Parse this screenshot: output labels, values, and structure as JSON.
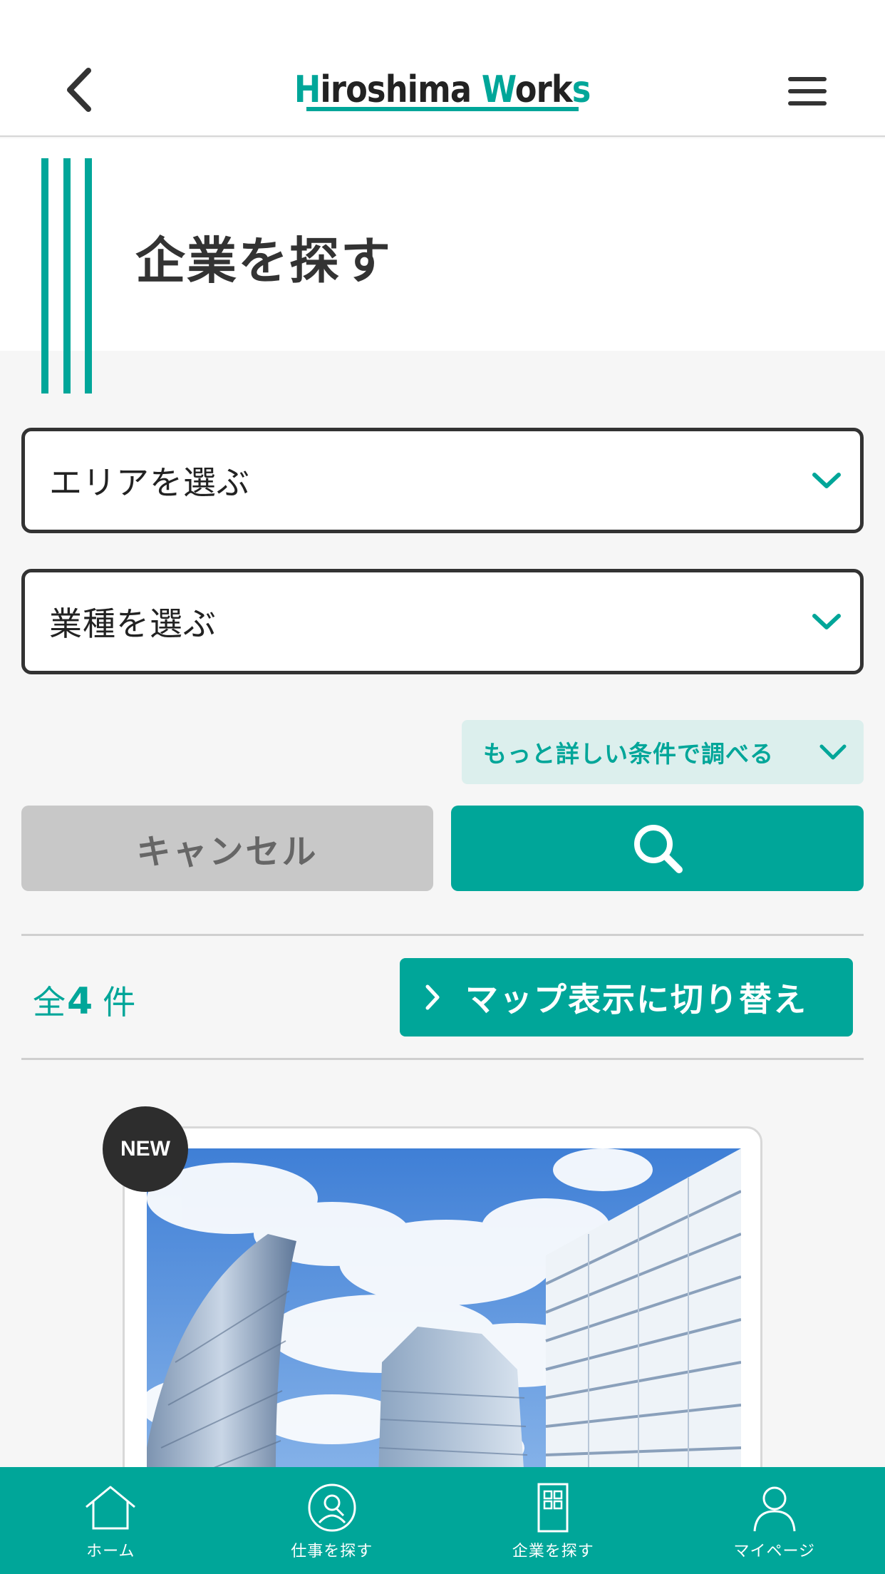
{
  "header": {
    "logo_prefix_H": "H",
    "logo_mid": "iroshima ",
    "logo_W": "W",
    "logo_ork": "ork",
    "logo_s": "s"
  },
  "page": {
    "title": "企業を探す"
  },
  "filters": {
    "area_select": "エリアを選ぶ",
    "industry_select": "業種を選ぶ",
    "more_filters": "もっと詳しい条件で調べる"
  },
  "actions": {
    "cancel": "キャンセル"
  },
  "results": {
    "prefix": "全",
    "count": "4",
    "suffix": "件",
    "map_toggle": "マップ表示に切り替え"
  },
  "card": {
    "badge": "NEW"
  },
  "tabbar": {
    "items": [
      {
        "label": "ホーム",
        "icon": "home-icon"
      },
      {
        "label": "仕事を探す",
        "icon": "job-search-icon"
      },
      {
        "label": "企業を探す",
        "icon": "company-icon"
      },
      {
        "label": "マイページ",
        "icon": "user-icon"
      }
    ]
  },
  "colors": {
    "accent": "#00a699",
    "accent_light": "#dcefed",
    "dark": "#333333",
    "cancel_bg": "#c8c8c8"
  }
}
